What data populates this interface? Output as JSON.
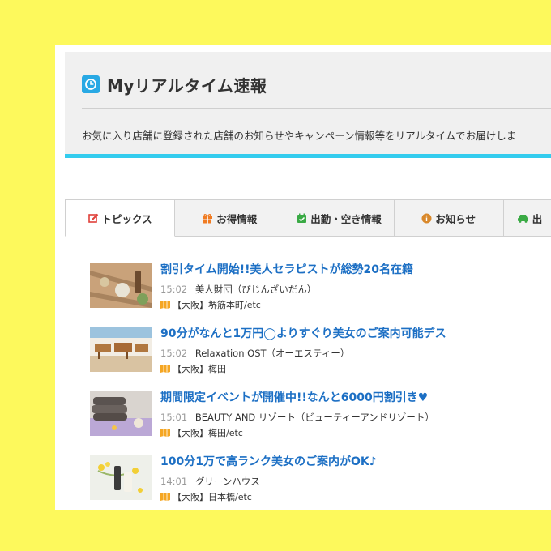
{
  "header": {
    "title": "Myリアルタイム速報",
    "description": "お気に入り店舗に登録された店舗のお知らせやキャンペーン情報等をリアルタイムでお届けしま"
  },
  "tabs": [
    {
      "label": "トピックス",
      "icon": "edit-icon",
      "active": true
    },
    {
      "label": "お得情報",
      "icon": "gift-icon",
      "active": false
    },
    {
      "label": "出勤・空き情報",
      "icon": "calendar-check-icon",
      "active": false
    },
    {
      "label": "お知らせ",
      "icon": "info-icon",
      "active": false
    },
    {
      "label": "出",
      "icon": "car-icon",
      "active": false
    }
  ],
  "items": [
    {
      "title": "割引タイム開始!!美人セラピストが総勢20名在籍",
      "time": "15:02",
      "shop": "美人財団（びじんざいだん）",
      "area": "【大阪】堺筋本町/etc"
    },
    {
      "title": "90分がなんと1万円◯よりすぐり美女のご案内可能デス",
      "time": "15:02",
      "shop": "Relaxation OST（オーエスティー）",
      "area": "【大阪】梅田"
    },
    {
      "title": "期間限定イベントが開催中!!なんと6000円割引き♥",
      "time": "15:01",
      "shop": "BEAUTY AND リゾート（ビューティーアンドリゾート）",
      "area": "【大阪】梅田/etc"
    },
    {
      "title": "100分1万で高ランク美女のご案内がOK♪",
      "time": "14:01",
      "shop": "グリーンハウス",
      "area": "【大阪】日本橋/etc"
    }
  ],
  "colors": {
    "background": "#fdf95c",
    "accent": "#33ccee",
    "link": "#1c6fc4",
    "clock_icon": "#29a9e4",
    "map_icon": "#f5a623"
  }
}
